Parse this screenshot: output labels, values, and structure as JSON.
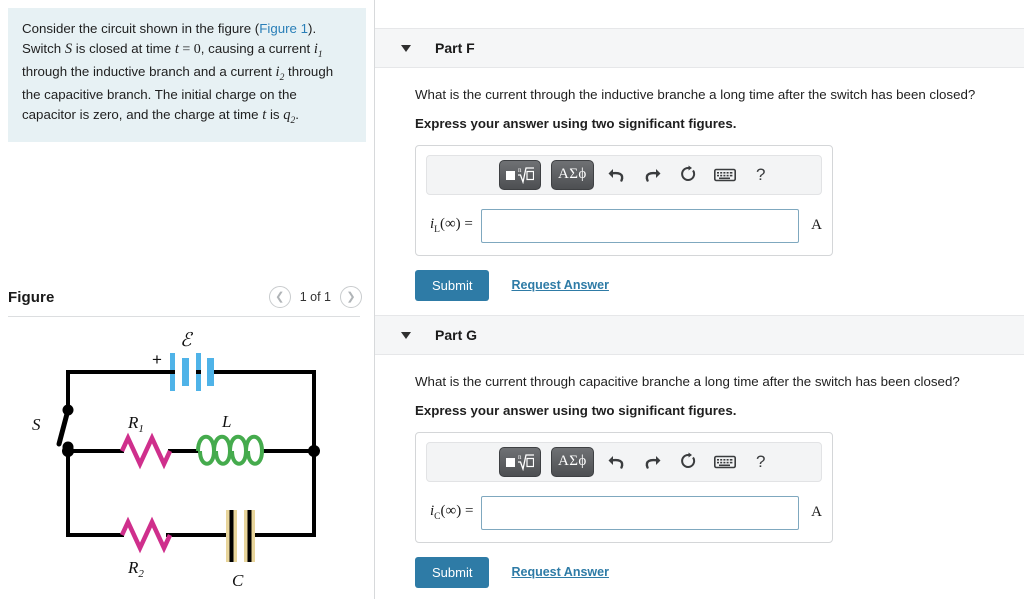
{
  "problem": {
    "text_segments": [
      {
        "t": "Consider the circuit shown in the figure (",
        "k": "plain"
      },
      {
        "t": "Figure 1",
        "k": "link"
      },
      {
        "t": "). Switch ",
        "k": "plain"
      },
      {
        "t": "S",
        "k": "var"
      },
      {
        "t": " is closed at time ",
        "k": "plain"
      },
      {
        "t": "t",
        "k": "var"
      },
      {
        "t": " = 0",
        "k": "num"
      },
      {
        "t": ", causing a current ",
        "k": "plain"
      },
      {
        "t": "i1",
        "k": "varsub"
      },
      {
        "t": " through the inductive branch and a current ",
        "k": "plain"
      },
      {
        "t": "i2",
        "k": "varsub"
      },
      {
        "t": " through the capacitive branch. The initial charge on the capacitor is zero, and the charge at time ",
        "k": "plain"
      },
      {
        "t": "t",
        "k": "var"
      },
      {
        "t": " is ",
        "k": "plain"
      },
      {
        "t": "q2",
        "k": "varsub"
      },
      {
        "t": ".",
        "k": "plain"
      }
    ],
    "figure_link_label": "Figure 1",
    "panel_color": "#e7f1f4"
  },
  "figure": {
    "title": "Figure",
    "pager": {
      "prev_icon": "chevron-left-icon",
      "next_icon": "chevron-right-icon",
      "label": "1 of 1"
    },
    "circuit": {
      "labels": {
        "emf": "ℰ",
        "plus": "+",
        "switch": "S",
        "r1": "R",
        "r1_sub": "1",
        "r2": "R",
        "r2_sub": "2",
        "inductor": "L",
        "capacitor": "C"
      },
      "colors": {
        "wire": "#000000",
        "battery": "#4fb3e8",
        "resistor": "#cf2f8c",
        "inductor": "#45ab4d",
        "capacitor_fill": "#e8d59b",
        "capacitor_plate": "#000000"
      }
    }
  },
  "parts": [
    {
      "id": "part-f",
      "title": "Part F",
      "caret_icon": "caret-down-icon",
      "question": "What is the current through the inductive branche a long time after the switch has been closed?",
      "instruction": "Express your answer using two significant figures.",
      "toolbar": {
        "template_button": {
          "icon": "math-template-icon",
          "label": "■ⁿ√□"
        },
        "symbols_button": {
          "icon": "greek-symbols-icon",
          "label": "ΑΣϕ"
        },
        "undo": {
          "icon": "undo-icon"
        },
        "redo": {
          "icon": "redo-icon"
        },
        "reset": {
          "icon": "reset-icon"
        },
        "keyboard": {
          "icon": "keyboard-icon"
        },
        "help": {
          "icon": "help-icon",
          "label": "?"
        }
      },
      "answer": {
        "label_var": "i",
        "label_sub": "L",
        "label_arg": "(∞) =",
        "value": "",
        "placeholder": "",
        "unit": "A"
      },
      "submit_label": "Submit",
      "request_label": "Request Answer"
    },
    {
      "id": "part-g",
      "title": "Part G",
      "caret_icon": "caret-down-icon",
      "question": "What is the current through capacitive branche a long time after the switch has been closed?",
      "instruction": "Express your answer using two significant figures.",
      "toolbar": {
        "template_button": {
          "icon": "math-template-icon",
          "label": "■ⁿ√□"
        },
        "symbols_button": {
          "icon": "greek-symbols-icon",
          "label": "ΑΣϕ"
        },
        "undo": {
          "icon": "undo-icon"
        },
        "redo": {
          "icon": "redo-icon"
        },
        "reset": {
          "icon": "reset-icon"
        },
        "keyboard": {
          "icon": "keyboard-icon"
        },
        "help": {
          "icon": "help-icon",
          "label": "?"
        }
      },
      "answer": {
        "label_var": "i",
        "label_sub": "C",
        "label_arg": "(∞) =",
        "value": "",
        "placeholder": "",
        "unit": "A"
      },
      "submit_label": "Submit",
      "request_label": "Request Answer"
    }
  ],
  "theme": {
    "accent": "#2e7ba6",
    "link": "#2a7fb8",
    "header_bg": "#f5f6f7"
  }
}
